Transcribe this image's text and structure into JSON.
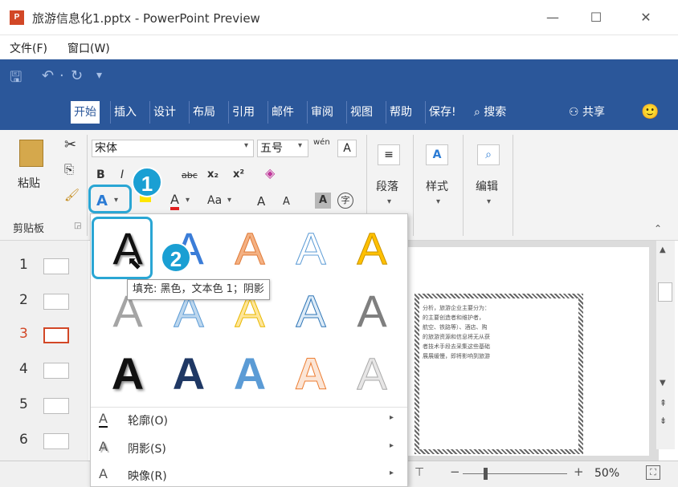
{
  "window": {
    "app_icon": "P",
    "title": "旅游信息化1.pptx - PowerPoint Preview",
    "minimize": "—",
    "maximize": "☐",
    "close": "✕"
  },
  "menu": {
    "file": "文件(F)",
    "window": "窗口(W)"
  },
  "qat": {
    "save": "🖫",
    "undo": "↶",
    "undo_dd": "·",
    "redo": "↻",
    "customize": "▾"
  },
  "tabs": [
    "开始",
    "插入",
    "设计",
    "布局",
    "引用",
    "邮件",
    "审阅",
    "视图",
    "帮助",
    "保存!"
  ],
  "tab_search": "搜索",
  "tab_share": "共享",
  "smiley": "🙂",
  "ribbon": {
    "paste_label": "粘贴",
    "font_name": "宋体",
    "font_size": "五号",
    "wen_label": "wén",
    "bold": "B",
    "italic": "I",
    "strikethrough": "abc",
    "subscript": "x₂",
    "superscript": "x²",
    "text_effects": "A",
    "font_color": "A",
    "aa": "Aa",
    "grow_font": "A",
    "shrink_font": "A",
    "char_shading": "A",
    "enclosed_char": "字",
    "paragraph": "段落",
    "styles": "样式",
    "editing": "编辑",
    "clipboard": "剪贴板"
  },
  "callouts": {
    "one": "1",
    "two": "2"
  },
  "thumbnails": [
    "1",
    "2",
    "3",
    "4",
    "5",
    "6"
  ],
  "active_thumbnail": 3,
  "wordart": {
    "glyph": "A",
    "tooltip": "填充: 黑色，文本色 1；阴影",
    "menu": [
      {
        "icon": "A",
        "label": "轮廓(O)"
      },
      {
        "icon": "A",
        "label": "阴影(S)"
      },
      {
        "icon": "A",
        "label": "映像(R)"
      }
    ],
    "submenu_arrow": "▸"
  },
  "slide_text": [
    "分析，旅游企业主要分为：",
    "的主要创造者和维护者，",
    "航空、铁路等）、酒店、购",
    "的旅游资源和信息将无从获",
    "者技术手段去采集这些基础",
    "展展缓慢，即将影响到旅游"
  ],
  "statusbar": {
    "zoom": "50%",
    "plus": "+",
    "minus": "−"
  },
  "colors": {
    "brand": "#2b579a",
    "accent": "#1a9fd3",
    "ppt": "#d24726"
  }
}
